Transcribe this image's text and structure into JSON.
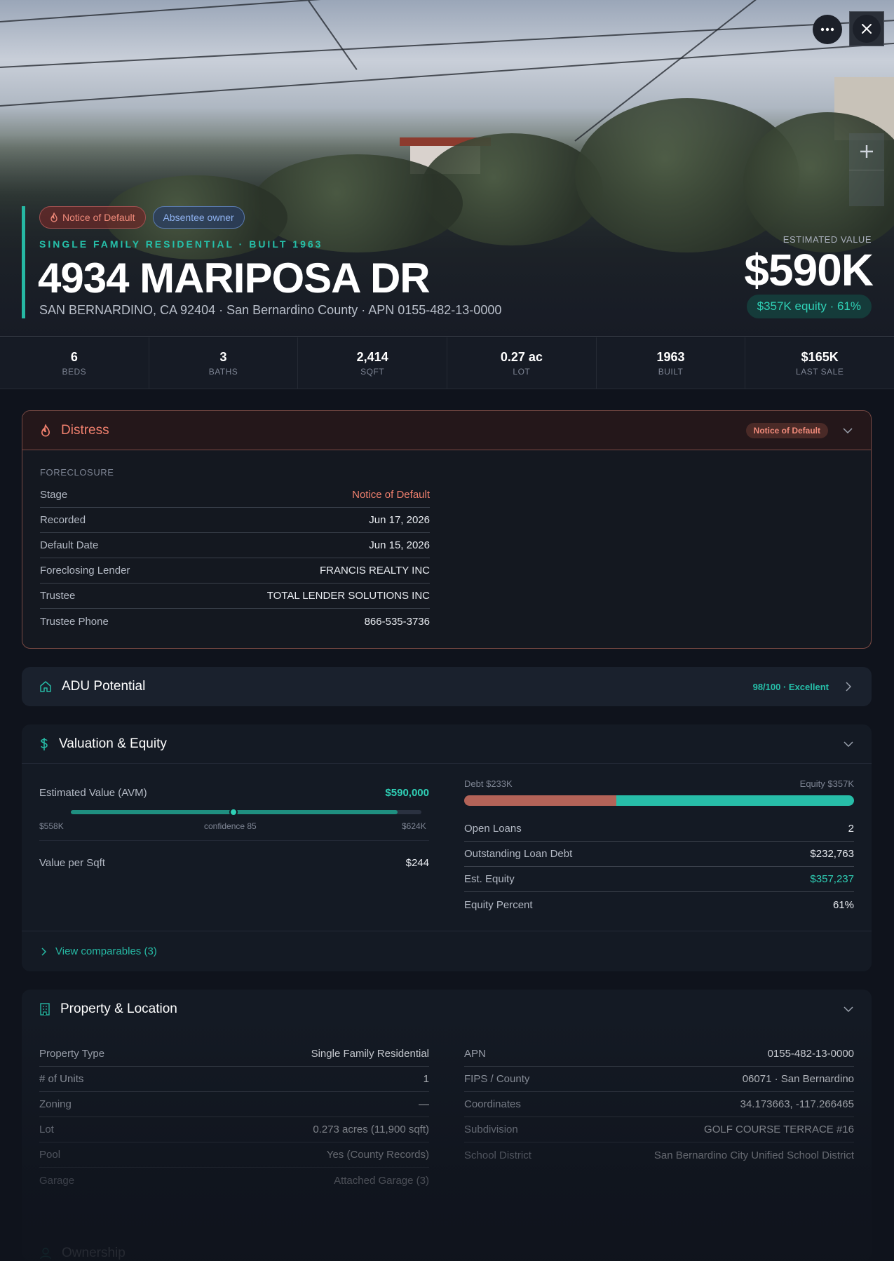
{
  "hero": {
    "badges": [
      {
        "label": "Notice of Default",
        "icon": "flame-icon"
      },
      {
        "label": "Absentee owner"
      }
    ],
    "property_type_line": "SINGLE FAMILY RESIDENTIAL · BUILT 1963",
    "address": "4934 MARIPOSA DR",
    "address_sub": "SAN BERNARDINO, CA 92404 · San Bernardino County · APN 0155-482-13-0000",
    "estimated_value_label": "ESTIMATED VALUE",
    "estimated_value": "$590K",
    "equity_pill": "$357K equity · 61%",
    "colors": {
      "accent": "#26b8a3",
      "distress": "#f0806e"
    }
  },
  "stats": [
    {
      "value": "6",
      "label": "BEDS"
    },
    {
      "value": "3",
      "label": "BATHS"
    },
    {
      "value": "2,414",
      "label": "SQFT"
    },
    {
      "value": "0.27 ac",
      "label": "LOT"
    },
    {
      "value": "1963",
      "label": "BUILT"
    },
    {
      "value": "$165K",
      "label": "LAST SALE"
    }
  ],
  "distress": {
    "title": "Distress",
    "badge": "Notice of Default",
    "section_label": "FORECLOSURE",
    "rows": [
      {
        "k": "Stage",
        "v": "Notice of Default"
      },
      {
        "k": "Recorded",
        "v": "Jun 17, 2026"
      },
      {
        "k": "Default Date",
        "v": "Jun 15, 2026"
      },
      {
        "k": "Foreclosing Lender",
        "v": "FRANCIS REALTY INC"
      },
      {
        "k": "Trustee",
        "v": "TOTAL LENDER SOLUTIONS INC"
      },
      {
        "k": "Trustee Phone",
        "v": "866-535-3736"
      }
    ]
  },
  "adu": {
    "title": "ADU Potential",
    "score": "98/100 · Excellent"
  },
  "valuation": {
    "title": "Valuation & Equity",
    "avm_label": "Estimated Value (AVM)",
    "avm_value": "$590,000",
    "range_low": "$558K",
    "range_high": "$624K",
    "confidence": "confidence 85",
    "value_per_sqft_label": "Value per Sqft",
    "value_per_sqft": "$244",
    "debt_label": "Debt $233K",
    "equity_label": "Equity $357K",
    "equity_share": 0.61,
    "rows": [
      {
        "k": "Open Loans",
        "v": "2"
      },
      {
        "k": "Outstanding Loan Debt",
        "v": "$232,763"
      },
      {
        "k": "Est. Equity",
        "v": "$357,237"
      },
      {
        "k": "Equity Percent",
        "v": "61%"
      }
    ],
    "comps_link": "View comparables (3)"
  },
  "property": {
    "title": "Property & Location",
    "left_rows": [
      {
        "k": "Property Type",
        "v": "Single Family Residential"
      },
      {
        "k": "# of Units",
        "v": "1"
      },
      {
        "k": "Zoning",
        "v": "—"
      },
      {
        "k": "Lot",
        "v": "0.273 acres (11,900 sqft)"
      },
      {
        "k": "Pool",
        "v": "Yes (County Records)"
      },
      {
        "k": "Garage",
        "v": "Attached Garage (3)"
      }
    ],
    "right_rows": [
      {
        "k": "APN",
        "v": "0155-482-13-0000"
      },
      {
        "k": "FIPS / County",
        "v": "06071 · San Bernardino"
      },
      {
        "k": "Coordinates",
        "v": "34.173663, -117.266465"
      },
      {
        "k": "Subdivision",
        "v": "GOLF COURSE TERRACE #16"
      },
      {
        "k": "School District",
        "v": "San Bernardino City Unified School District"
      }
    ]
  },
  "ownership": {
    "title": "Ownership"
  }
}
